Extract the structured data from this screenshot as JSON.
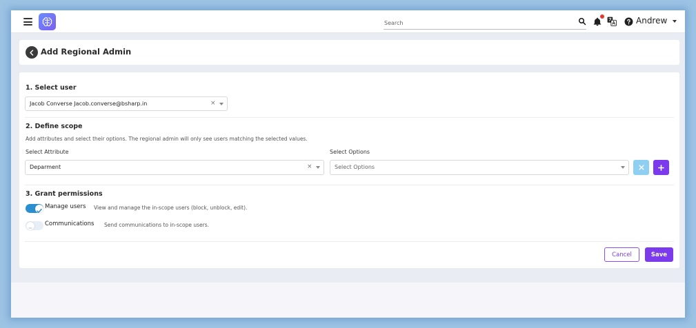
{
  "topbar": {
    "search_placeholder": "Search",
    "user_name": "Andrew",
    "notification_dot_color": "#e53935"
  },
  "page": {
    "title": "Add Regional Admin"
  },
  "select_user": {
    "heading": "1. Select user",
    "selected_value": "Jacob Converse Jacob.converse@bsharp.in",
    "clear_glyph": "×"
  },
  "define_scope": {
    "heading": "2. Define scope",
    "hint": "Add attributes and select their options. The regional admin will only see users matching the selected values.",
    "attribute_label": "Select Attribute",
    "attribute_value": "Deparment",
    "options_label": "Select Options",
    "options_placeholder": "Select Options",
    "clear_glyph": "×"
  },
  "grant_permissions": {
    "heading": "3. Grant permissions",
    "items": [
      {
        "label": "Manage users",
        "description": "View and manage the in-scope users (block, unblock, edit).",
        "enabled": true
      },
      {
        "label": "Communications",
        "description": "Send communications to in-scope users.",
        "enabled": false
      }
    ]
  },
  "actions": {
    "cancel_label": "Cancel",
    "save_label": "Save"
  },
  "colors": {
    "accent": "#7c3aed",
    "toggle_on": "#2a8fd0",
    "remove_button": "#8fd0f2"
  }
}
